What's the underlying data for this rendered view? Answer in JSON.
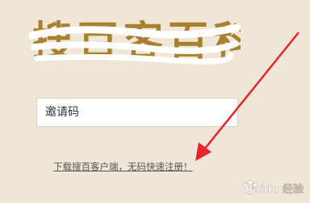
{
  "header": {
    "logo_text": "搜百客百科"
  },
  "form": {
    "invite_code_placeholder": "邀请码"
  },
  "footer": {
    "download_link": "下载搜百客户端，无码快速注册！"
  },
  "overlay": {
    "watermark_text": "Baidu 经验",
    "arrow_color": "#e8242a"
  }
}
